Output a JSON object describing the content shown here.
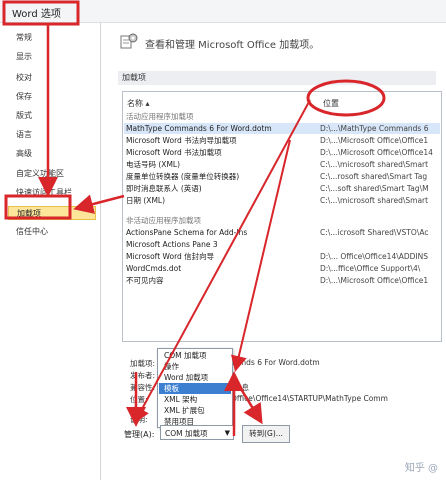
{
  "window": {
    "title": "Word 选项"
  },
  "sidebar": {
    "items": [
      {
        "label": "常规"
      },
      {
        "label": "显示"
      },
      {
        "label": "校对"
      },
      {
        "label": "保存"
      },
      {
        "label": "版式"
      },
      {
        "label": "语言"
      },
      {
        "label": "高级"
      },
      {
        "label": "自定义功能区"
      },
      {
        "label": "快速访问工具栏"
      },
      {
        "label": "加载项",
        "active": true
      },
      {
        "label": "信任中心"
      }
    ]
  },
  "header": {
    "text": "查看和管理 Microsoft Office 加载项。"
  },
  "section": {
    "label": "加载项"
  },
  "list": {
    "col_name": "名称 ▴",
    "col_location": "位置",
    "active_group": "活动应用程序加载项",
    "active": [
      {
        "name": "MathType Commands 6 For Word.dotm",
        "location": "D:\\...\\MathType Commands 6"
      },
      {
        "name": "Microsoft Word 书法向导加载项",
        "location": "D:\\...\\Microsoft Office\\Office1"
      },
      {
        "name": "Microsoft Word 书法加载项",
        "location": "D:\\...\\Microsoft Office\\Office14"
      },
      {
        "name": "电话号码 (XML)",
        "location": "C:\\...\\microsoft shared\\Smart"
      },
      {
        "name": "度量单位转换器 (度量单位转换器)",
        "location": "C:\\...rosoft shared\\Smart Tag"
      },
      {
        "name": "即时消息联系人 (英语)",
        "location": "C:\\...soft shared\\Smart Tag\\M"
      },
      {
        "name": "日期 (XML)",
        "location": "C:\\...\\microsoft shared\\Smart"
      }
    ],
    "inactive_group": "非活动应用程序加载项",
    "inactive": [
      {
        "name": "ActionsPane Schema for Add-Ins",
        "location": "C:\\...icrosoft Shared\\VSTO\\Ac"
      },
      {
        "name": "Microsoft Actions Pane 3",
        "location": ""
      },
      {
        "name": "Microsoft Word 信封向导",
        "location": "D:\\... Office\\Office14\\ADDINS"
      },
      {
        "name": "WordCmds.dot",
        "location": "D:\\...ffice\\Office Support\\4\\"
      },
      {
        "name": "不可见内容",
        "location": "D:\\...\\Microsoft Office\\Office1"
      }
    ]
  },
  "details": {
    "addin_label": "加载项:",
    "addin_value": "MathType Commands 6 For Word.dotm",
    "publisher_label": "发布者:",
    "compat_label": "兼容性:",
    "compat_value": "没有可用的兼容性信息",
    "location_label": "位置:",
    "location_value": "D:\\...\\Microsoft Office\\Office14\\STARTUP\\MathType Comm",
    "desc_label": "说明:"
  },
  "dropdown": {
    "options": [
      "COM 加载项",
      "操作",
      "Word 加载项",
      "模板",
      "XML 架构",
      "XML 扩展包",
      "禁用项目"
    ],
    "selected_index": 3
  },
  "manage": {
    "label": "管理(A):",
    "value": "COM 加载项",
    "go_label": "转到(G)..."
  },
  "watermark": "知乎 @",
  "colors": {
    "annotation_red": "#d8262b",
    "active_nav": "#fde59a",
    "selected": "#3c7fd1"
  }
}
